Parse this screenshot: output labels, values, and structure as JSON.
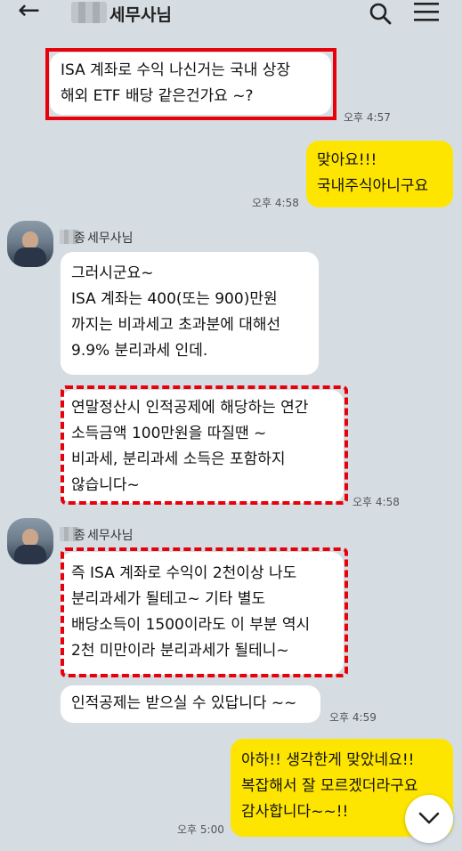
{
  "header": {
    "title": "세무사님",
    "icons": [
      "back-arrow-icon",
      "search-icon",
      "menu-icon"
    ]
  },
  "messages": [
    {
      "text": "ISA 계좌로 수익 나신거는 국내 상장\n해외 ETF 배당 같은건가요 ~?",
      "time": "오후 4:57",
      "side": "me"
    },
    {
      "text": "맞아요!!!\n국내주식아니구요",
      "time": "오후 4:58",
      "side": "me"
    },
    {
      "sender": "세무사님",
      "sender_prefix": "종",
      "text": "그러시군요~\nISA 계좌는 400(또는 900)만원\n까지는 비과세고 초과분에 대해선\n9.9% 분리과세 인데.",
      "side": "other"
    },
    {
      "text": "연말정산시 인적공제에 해당하는 연간\n소득금액 100만원을 따질땐 ~\n비과세, 분리과세 소득은 포함하지\n않습니다~",
      "time": "오후 4:58",
      "side": "other"
    },
    {
      "sender": "세무사님",
      "sender_prefix": "종",
      "text": "즉 ISA 계좌로 수익이 2천이상 나도\n분리과세가 될테고~ 기타 별도\n배당소득이 1500이라도 이 부분 역시\n2천 미만이라 분리과세가 될테니~",
      "side": "other"
    },
    {
      "text": "인적공제는 받으실 수 있답니다 ~~",
      "time": "오후 4:59",
      "side": "other"
    },
    {
      "text": "아하!! 생각한게 맞았네요!!\n복잡해서 잘 모르겠더라구요\n감사합니다~~!!",
      "time": "오후 5:00",
      "side": "me"
    }
  ],
  "scroll_button": {
    "icon": "chevron-down-icon"
  },
  "colors": {
    "background": "#d5dde3",
    "my_bubble": "#fee500",
    "highlight": "#e8000b"
  }
}
